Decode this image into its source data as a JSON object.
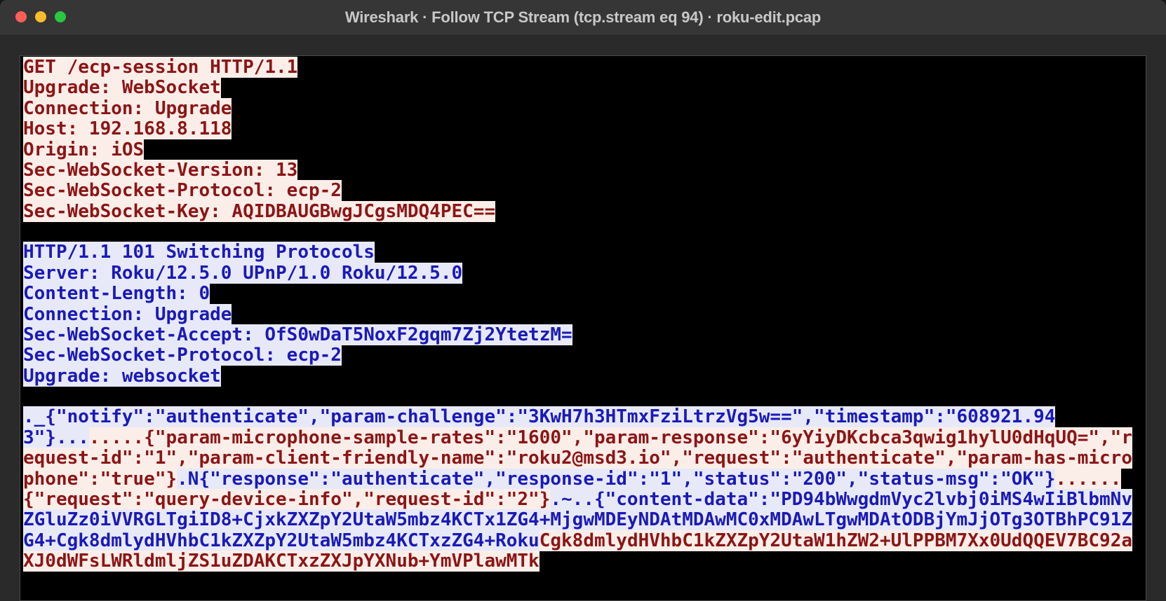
{
  "window": {
    "title": "Wireshark · Follow TCP Stream (tcp.stream eq 94) · roku-edit.pcap"
  },
  "stream": {
    "request": "GET /ecp-session HTTP/1.1\nUpgrade: WebSocket\nConnection: Upgrade\nHost: 192.168.8.118\nOrigin: iOS\nSec-WebSocket-Version: 13\nSec-WebSocket-Protocol: ecp-2\nSec-WebSocket-Key: AQIDBAUGBwgJCgsMDQ4PEC==",
    "response": "HTTP/1.1 101 Switching Protocols\nServer: Roku/12.5.0 UPnP/1.0 Roku/12.5.0\nContent-Length: 0\nConnection: Upgrade\nSec-WebSocket-Accept: OfS0wDaT5NoxF2gqm7Zj2YtetzM=\nSec-WebSocket-Protocol: ecp-2\nUpgrade: websocket",
    "seg1": "._{\"notify\":\"authenticate\",\"param-challenge\":\"3KwH7h3HTmxFziLtrzVg5w==\",\"timestamp\":\"608921.943\"}...",
    "seg2": ".....{\"param-microphone-sample-rates\":\"1600\",\"param-response\":\"6yYiyDKcbca3qwig1hylU0dHqUQ=\",\"request-id\":\"1\",\"param-client-friendly-name\":\"roku2@msd3.io\",\"request\":\"authenticate\",\"param-has-microphone\":\"true\"}",
    "seg3": ".N{\"response\":\"authenticate\",\"response-id\":\"1\",\"status\":\"200\",\"status-msg\":\"OK\"}",
    "seg4": "......{\"request\":\"query-device-info\",\"request-id\":\"2\"}",
    "seg5": ".~..{\"content-data\":\"PD94bWwgdmVyc2lvbj0iMS4wIiBlbmNvZGluZz0iVVRGLTgiID8+CjxkZXZpY2UtaW5mbz4KCTx1ZG4+MjgwMDEyNDAtMDAwMC0xMDAwLTgwMDAtODBjYmJjOTg3OTBhPC91ZG4+Cgk8dmlydHVhbC1kZXZpY2UtaW5mbz4KCTxzZG4+Roku",
    "seg6": "Cgk8dmlydHVhbC1kZXZpY2UtaW1hZW2+UlPPBM7Xx0UdQQEV7BC92aXJ0dWFsLWRldmljZS1uZDAKCTxzZXJpYXNub+YmVPlawMTk"
  }
}
